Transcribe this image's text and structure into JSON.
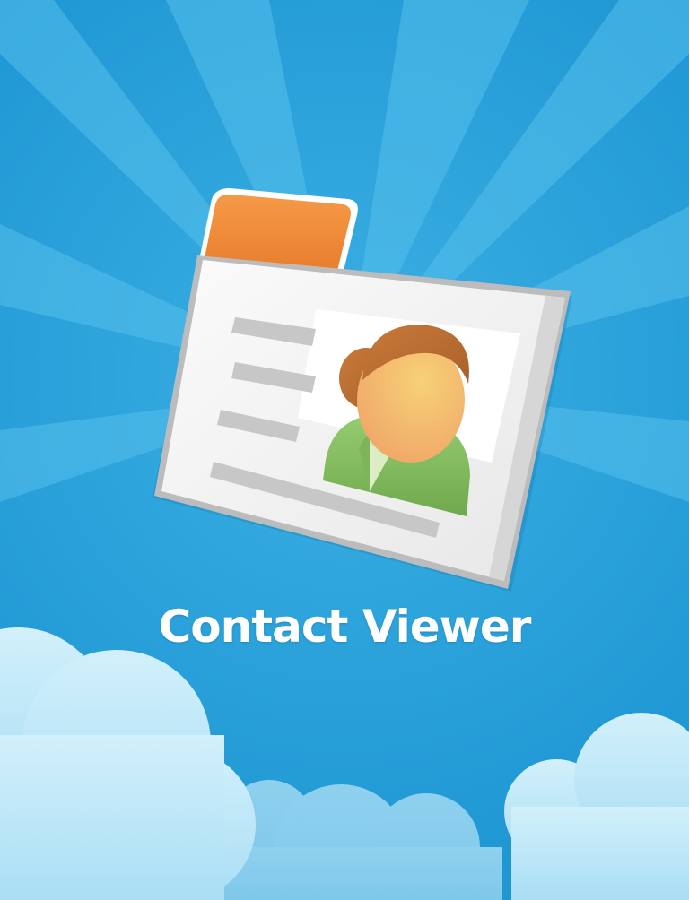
{
  "app": {
    "title": "Contact Viewer"
  },
  "icons": {
    "main": "contact-card-icon",
    "portrait": "person-avatar-icon"
  },
  "colors": {
    "background": "#2aa3dc",
    "rays": "#53bdea",
    "card_tab": "#f08d3c",
    "card_body": "#f1f1f1",
    "shirt": "#8dc26a",
    "hair": "#c8743a",
    "face": "#f5c173",
    "cloud": "#b7e6f8",
    "title_text": "#ffffff"
  }
}
